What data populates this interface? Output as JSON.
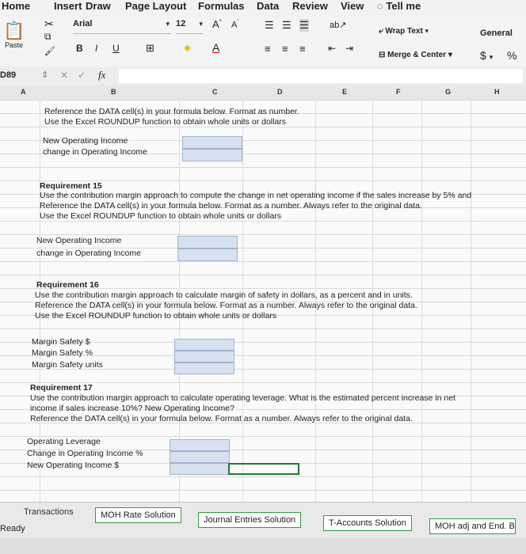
{
  "ribbon_tabs": [
    "Home",
    "Insert",
    "Draw",
    "Page Layout",
    "Formulas",
    "Data",
    "Review",
    "View"
  ],
  "tell_me": "Tell me",
  "clipboard": {
    "paste_label": "Paste"
  },
  "font": {
    "name": "Arial",
    "size": "12",
    "bold": "B",
    "italic": "I",
    "underline": "U"
  },
  "alignment": {
    "wrap_text": "Wrap Text",
    "merge_center": "Merge & Center"
  },
  "number": {
    "format": "General",
    "currency": "$",
    "percent": "%"
  },
  "formula_bar": {
    "name_box": "D89",
    "fx": "fx"
  },
  "columns": [
    "A",
    "B",
    "C",
    "D",
    "E",
    "F",
    "G",
    "H"
  ],
  "sheet": {
    "intro": [
      "Reference the DATA cell(s) in your formula below. Format as number.",
      "Use the Excel ROUNDUP function to obtain whole units or dollars"
    ],
    "block1_labels": [
      "New Operating Income",
      "change in Operating Income"
    ],
    "req15": {
      "title": "Requirement 15",
      "lines": [
        "Use the contribution margin approach to compute the change in net operating income if the sales increase by 5% and",
        "Reference the DATA cell(s) in your formula below. Format as a number. Always refer to the original data.",
        "Use the Excel ROUNDUP function to obtain whole units or dollars"
      ],
      "labels": [
        "New Operating Income",
        "change in Operating Income"
      ]
    },
    "req16": {
      "title": "Requirement 16",
      "lines": [
        "Use the contribution margin approach to calculate margin of safety in dollars, as a percent and in units.",
        "Reference the DATA cell(s) in your formula below. Format as a number. Always refer to the original data.",
        "Use the Excel ROUNDUP function to obtain whole units or dollars"
      ],
      "labels": [
        "Margin Safety $",
        "Margin Safety %",
        "Margin Safety units"
      ]
    },
    "req17": {
      "title": "Requirement 17",
      "lines": [
        "Use the contribution margin approach to calculate operating leverage. What is the estimated percent increase in net",
        "income if sales increase 10%? New Operating Income?",
        "Reference the DATA cell(s) in your formula below. Format as a number. Always refer to the original data."
      ],
      "labels": [
        "Operating Leverage",
        "Change in Operating Income %",
        "New Operating Income $"
      ]
    }
  },
  "sheet_tabs": [
    "Transactions",
    "MOH Rate Solution",
    "Journal Entries Solution",
    "T-Accounts Solution",
    "MOH adj and End. B"
  ],
  "status": "Ready",
  "colors": {
    "input_fill": "#d7e1f0",
    "sheet_tab_outline": "#2e9e3e",
    "selection": "#1e7a36"
  }
}
